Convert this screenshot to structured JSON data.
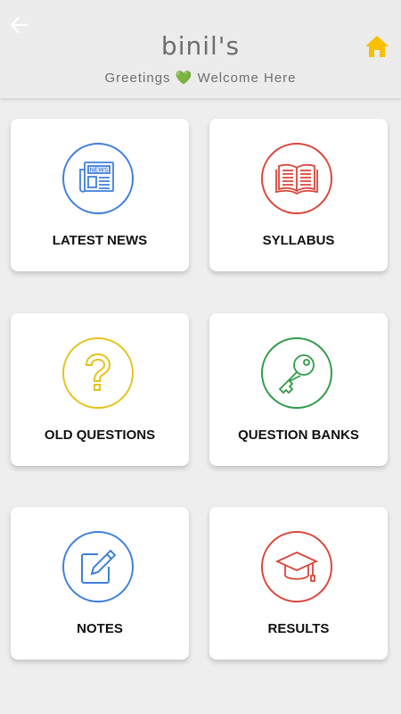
{
  "header": {
    "logo_text": "binil's",
    "greeting_left": "Greetings",
    "greeting_heart": "💚",
    "greeting_right": "Welcome Here"
  },
  "menu": [
    {
      "label": "LATEST NEWS",
      "icon": "newspaper-icon",
      "color": "#3f7fdc"
    },
    {
      "label": "SYLLABUS",
      "icon": "open-book-icon",
      "color": "#d9463b"
    },
    {
      "label": "OLD QUESTIONS",
      "icon": "question-mark-icon",
      "color": "#e6c21a"
    },
    {
      "label": "QUESTION BANKS",
      "icon": "key-icon",
      "color": "#2e9b47"
    },
    {
      "label": "NOTES",
      "icon": "edit-note-icon",
      "color": "#3f7fdc"
    },
    {
      "label": "RESULTS",
      "icon": "graduation-cap-icon",
      "color": "#d9463b"
    }
  ],
  "colors": {
    "home_icon": "#f6c000",
    "background": "#eeeeee"
  }
}
